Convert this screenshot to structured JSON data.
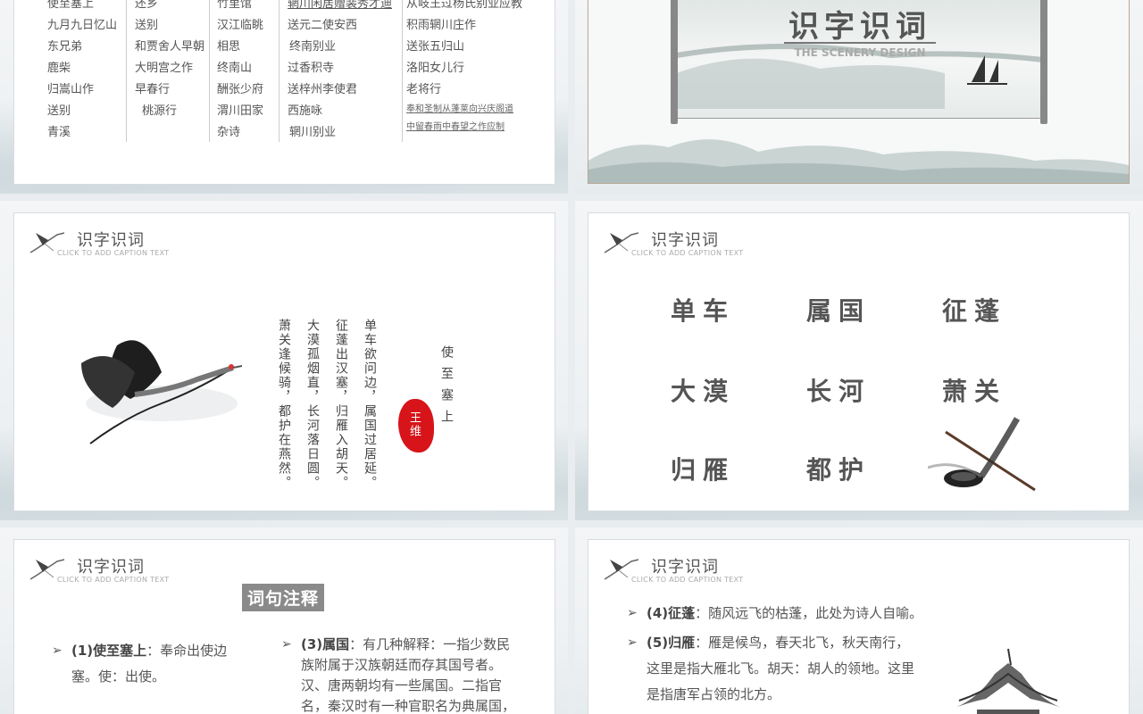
{
  "slide1": {
    "col1": [
      "使至塞上",
      "九月九日忆山",
      "东兄弟",
      "鹿柴",
      "归嵩山作",
      "送别",
      "青溪"
    ],
    "col2": [
      "还乡",
      "送别",
      "和贾舍人早朝",
      "大明宫之作",
      "早春行",
      "桃源行"
    ],
    "col3": [
      "竹里馆",
      "汉江临眺",
      "相思",
      "终南山",
      "酬张少府",
      "渭川田家",
      "杂诗"
    ],
    "col4": [
      "辋川闲居赠裴秀才迪",
      "送元二使安西",
      "终南别业",
      "过香积寺",
      "送梓州李使君",
      "西施咏",
      "辋川别业"
    ],
    "col5": [
      "从岐王过杨氏别业应教",
      "积雨辋川庄作",
      "送张五归山",
      "洛阳女儿行",
      "老将行"
    ],
    "col5_small": [
      "奉和圣制从蓬莱向兴庆阁道",
      "中留春雨中春望之作应制"
    ]
  },
  "slide2": {
    "title": "识字识词",
    "subtitle": "THE SCENERY DESIGN"
  },
  "header": {
    "title": "识字识词",
    "caption": "CLICK TO ADD CAPTION TEXT"
  },
  "slide3": {
    "poem_title": "使至塞上",
    "author": "王维",
    "lines": [
      "单车欲问边，属国过居延。",
      "征蓬出汉塞，归雁入胡天。",
      "大漠孤烟直，长河落日圆。",
      "萧关逢候骑，都护在燕然。"
    ]
  },
  "slide4": {
    "words": [
      "单车",
      "属国",
      "征蓬",
      "大漠",
      "长河",
      "萧关",
      "归雁",
      "都护"
    ]
  },
  "slide5": {
    "section_title": "词句注释",
    "note1_head": "(1)使至塞上",
    "note1_text": "：奉命出使边",
    "note1_text2": "塞。使：出使。",
    "note3_head": "(3)属国",
    "note3_text": "：有几种解释：一指少数民",
    "note3_lines": [
      "族附属于汉族朝廷而存其国号者。",
      "汉、唐两朝均有一些属国。二指官",
      "名，秦汉时有一种官职名为典属国，"
    ]
  },
  "slide6": {
    "note4_head": "(4)征蓬",
    "note4_text": "：随风远飞的枯蓬，此处为诗人自喻。",
    "note5_head": "(5)归雁",
    "note5_text": "：雁是候鸟，春天北飞，秋天南行，",
    "note5_lines": [
      "这里是指大雁北飞。胡天：胡人的领地。这里",
      "是指唐军占领的北方。"
    ]
  }
}
